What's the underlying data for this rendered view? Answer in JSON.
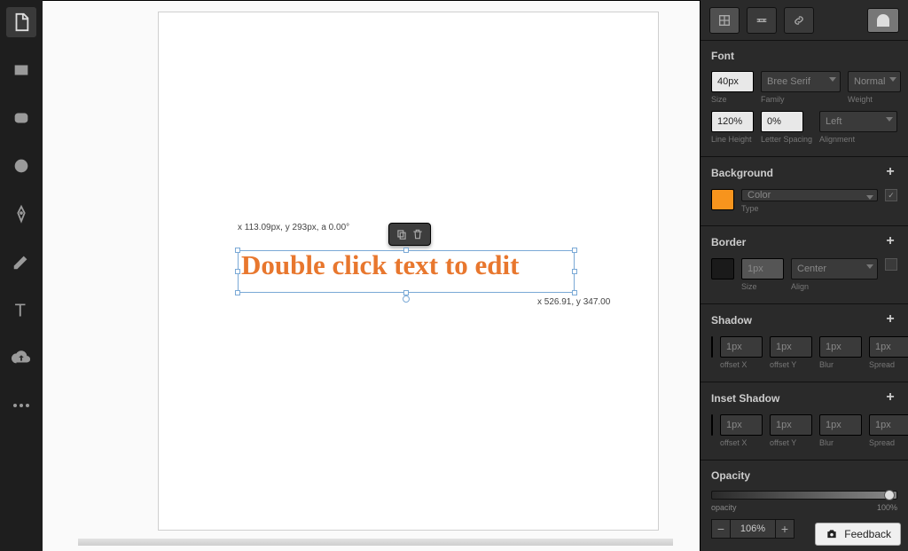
{
  "toolbar": {
    "tools": [
      "document",
      "rectangle",
      "rounded-rect",
      "ellipse",
      "pen",
      "pencil",
      "text",
      "upload",
      "more"
    ]
  },
  "canvas": {
    "text_content": "Double click text to edit",
    "coords_tl": "x 113.09px, y 293px, a 0.00°",
    "coords_br": "x 526.91, y 347.00"
  },
  "panel": {
    "font": {
      "title": "Font",
      "size_value": "40px",
      "size_label": "Size",
      "family_value": "Bree Serif",
      "family_label": "Family",
      "weight_value": "Normal",
      "weight_label": "Weight",
      "lineheight_value": "120%",
      "lineheight_label": "Line Height",
      "spacing_value": "0%",
      "spacing_label": "Letter Spacing",
      "align_value": "Left",
      "align_label": "Alignment"
    },
    "background": {
      "title": "Background",
      "color_hex": "#f7941d",
      "type_value": "Color",
      "type_label": "Type"
    },
    "border": {
      "title": "Border",
      "size_value": "1px",
      "size_label": "Size",
      "align_value": "Center",
      "align_label": "Align"
    },
    "shadow": {
      "title": "Shadow",
      "ox_value": "1px",
      "ox_label": "offset X",
      "oy_value": "1px",
      "oy_label": "offset Y",
      "blur_value": "1px",
      "blur_label": "Blur",
      "spread_value": "1px",
      "spread_label": "Spread"
    },
    "inset": {
      "title": "Inset Shadow",
      "ox_value": "1px",
      "ox_label": "offset X",
      "oy_value": "1px",
      "oy_label": "offset Y",
      "blur_value": "1px",
      "blur_label": "Blur",
      "spread_value": "1px",
      "spread_label": "Spread"
    },
    "opacity": {
      "title": "Opacity",
      "label": "opacity",
      "max": "100%",
      "value": "106%"
    }
  },
  "feedback_label": "Feedback"
}
